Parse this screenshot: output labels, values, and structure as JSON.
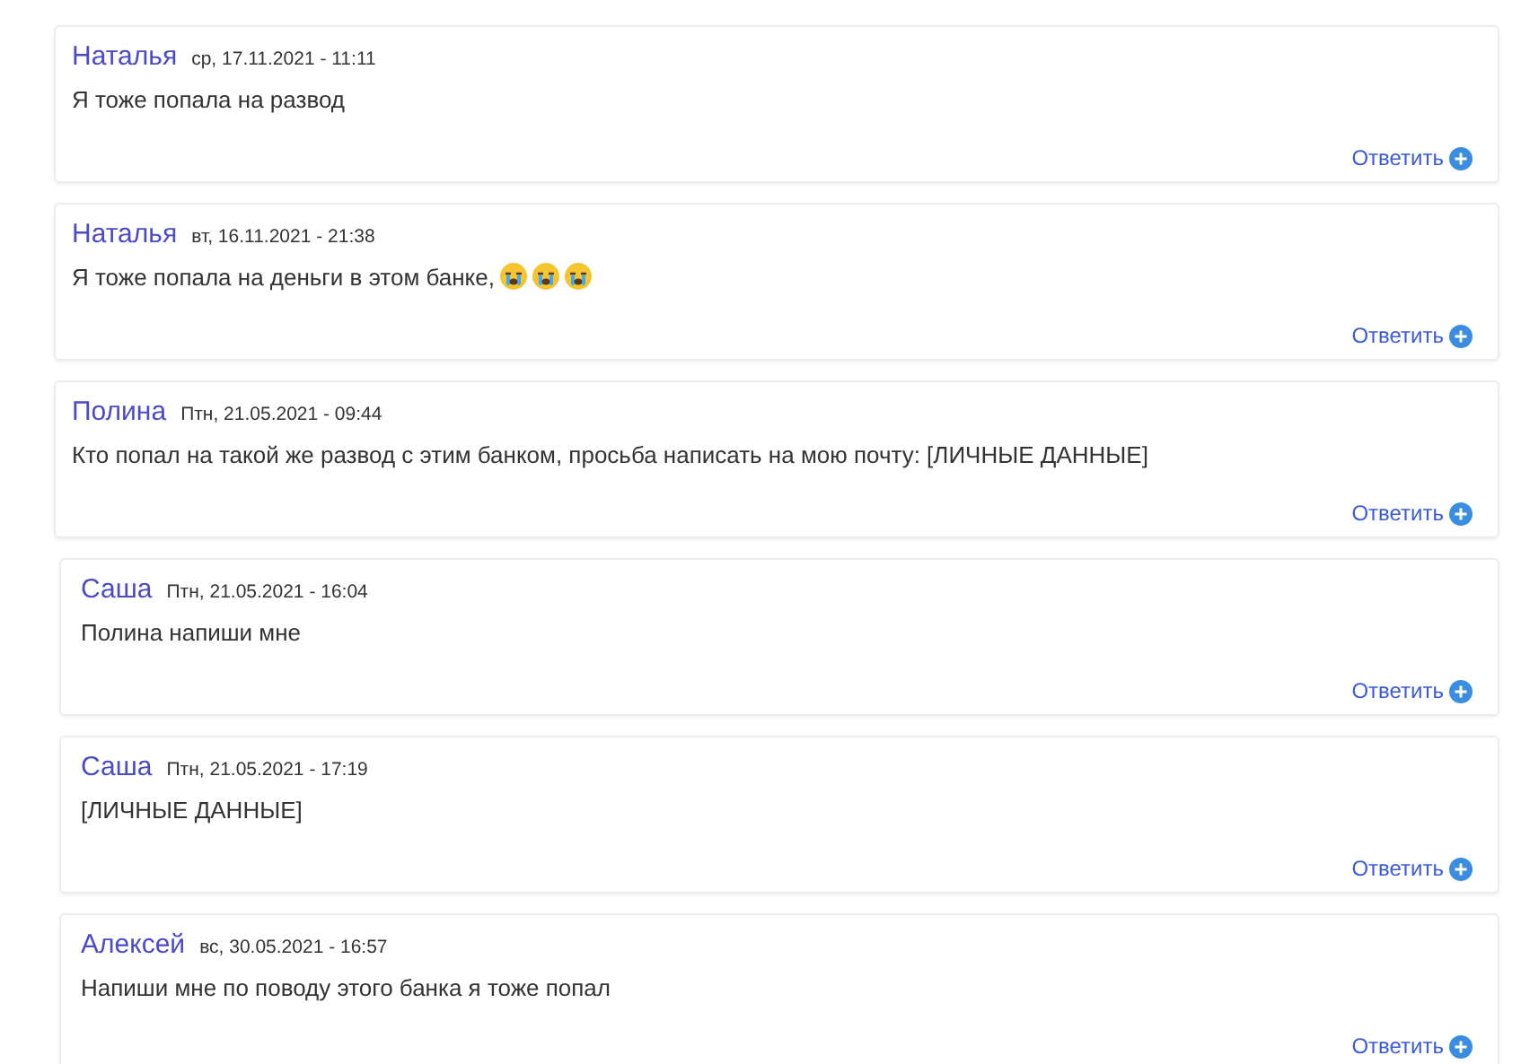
{
  "comments": [
    {
      "author": "Наталья",
      "date": "ср, 17.11.2021 - 11:11",
      "text": "Я тоже попала на развод",
      "reply": "Ответить"
    },
    {
      "author": "Наталья",
      "date": "вт, 16.11.2021 - 21:38",
      "text": "Я тоже попала на деньги в этом банке,",
      "emojis": [
        {
          "kind": "crying"
        },
        {
          "kind": "crying"
        },
        {
          "kind": "crying"
        }
      ],
      "reply": "Ответить"
    },
    {
      "author": "Полина",
      "date": "Птн, 21.05.2021 - 09:44",
      "text": "Кто попал на такой же развод с этим банком, просьба написать на мою почту: [ЛИЧНЫЕ ДАННЫЕ]",
      "reply": "Ответить",
      "children": [
        {
          "author": "Саша",
          "date": "Птн, 21.05.2021 - 16:04",
          "text": "Полина напиши мне",
          "reply": "Ответить"
        },
        {
          "author": "Саша",
          "date": "Птн, 21.05.2021 - 17:19",
          "text": "[ЛИЧНЫЕ ДАННЫЕ]",
          "reply": "Ответить"
        },
        {
          "author": "Алексей",
          "date": "вс, 30.05.2021 - 16:57",
          "text": "Напиши мне по поводу этого банка я тоже попал",
          "reply": "Ответить"
        }
      ]
    }
  ]
}
